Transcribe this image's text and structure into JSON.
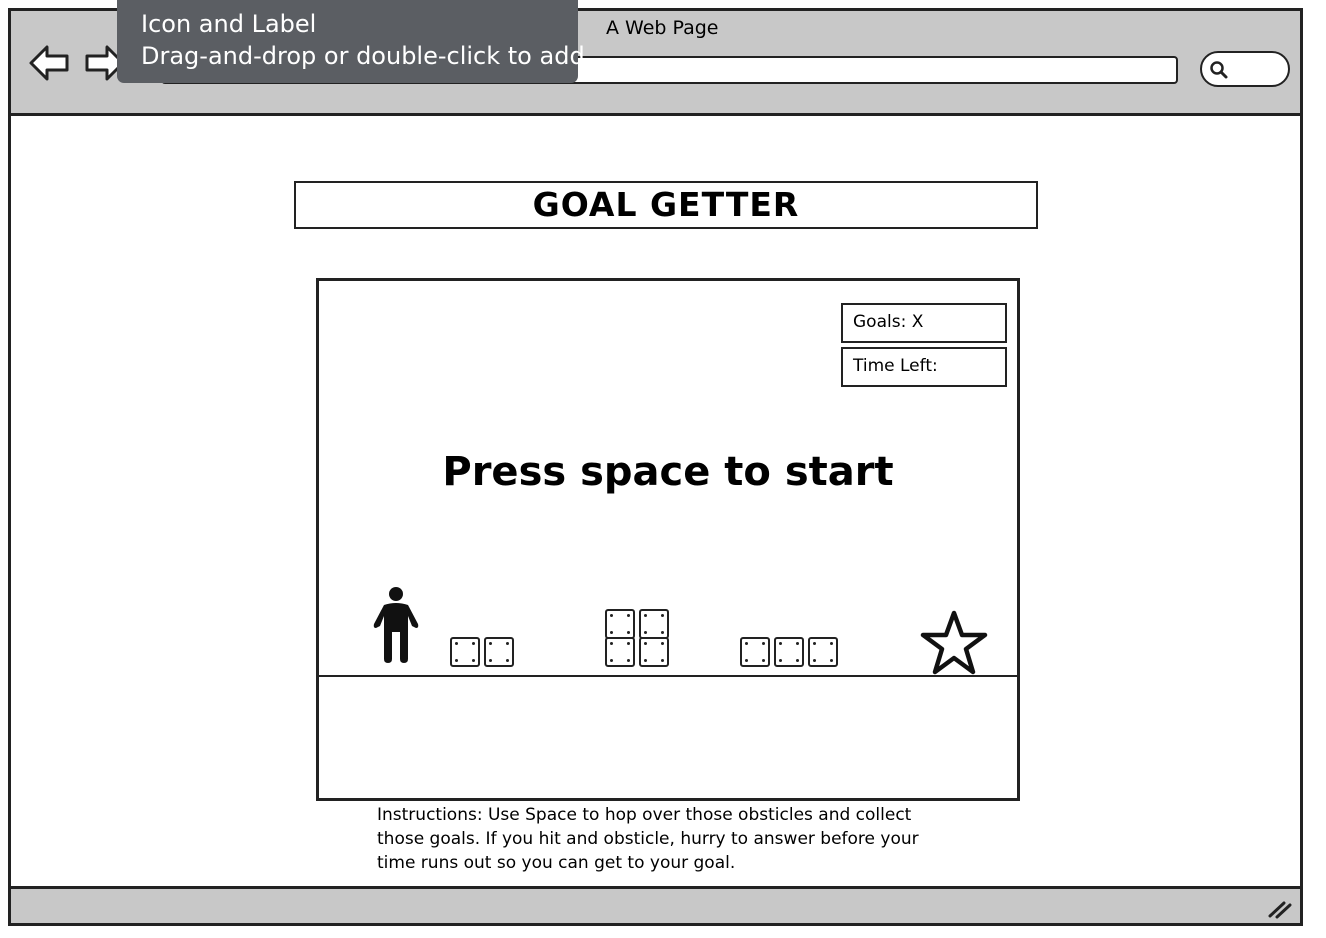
{
  "browser": {
    "page_title": "A Web Page",
    "url": "",
    "search": ""
  },
  "tooltip": {
    "title": "Icon and Label",
    "hint": "Drag-and-drop or double-click to add"
  },
  "game": {
    "title": "GOAL GETTER",
    "goals_label": "Goals: X",
    "time_left_label": "Time Left:",
    "start_prompt": "Press space to start",
    "player_icon": "person-icon",
    "goal_icon": "star-icon",
    "obstacle_icon": "crate-block-icon",
    "obstacles": [
      {
        "name": "obstacle-pair",
        "columns": 2,
        "rows": 1
      },
      {
        "name": "obstacle-stack",
        "columns": 2,
        "rows": 2
      },
      {
        "name": "obstacle-triple",
        "columns": 3,
        "rows": 1
      }
    ]
  },
  "instructions": "Instructions: Use Space to hop over those obsticles and collect those goals. If you hit and obsticle, hurry to answer before your time runs out so you can get to your goal.",
  "colors": {
    "chrome_gray": "#c8c8c8",
    "tooltip_bg": "#5b5e63",
    "stroke": "#222222"
  }
}
